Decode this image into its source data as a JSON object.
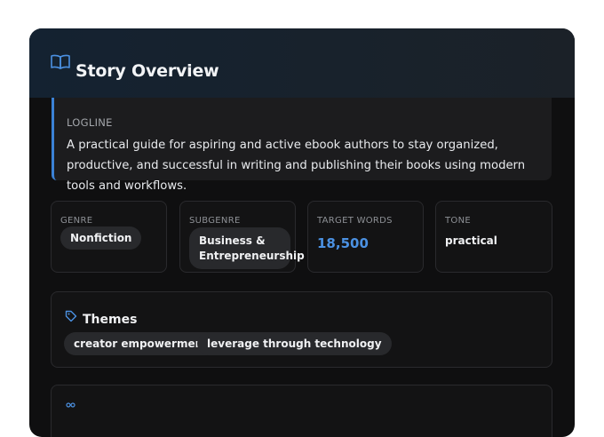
{
  "header": {
    "title": "Story Overview",
    "icon": "book-open-icon"
  },
  "logline": {
    "label": "LOGLINE",
    "text": "A practical guide for aspiring and active ebook authors to stay organized, productive, and successful in writing and publishing their books using modern tools and workflows."
  },
  "stats": {
    "genre": {
      "label": "GENRE",
      "value": "Nonfiction"
    },
    "subgenre": {
      "label": "SUBGENRE",
      "value": "Business & Entrepreneurship"
    },
    "target_words": {
      "label": "TARGET WORDS",
      "value": "18,500"
    },
    "tone": {
      "label": "TONE",
      "value": "practical"
    }
  },
  "themes": {
    "title": "Themes",
    "icon": "tag-icon",
    "items": [
      "creator empowerment",
      "leverage through technology"
    ]
  },
  "next_section": {
    "icon": "users-icon"
  },
  "colors": {
    "accent": "#3b82d6",
    "card_bg": "#0f0f10",
    "panel_bg": "#1c1c1e",
    "pill_bg": "#28292c",
    "value_blue": "#4b91e2"
  }
}
